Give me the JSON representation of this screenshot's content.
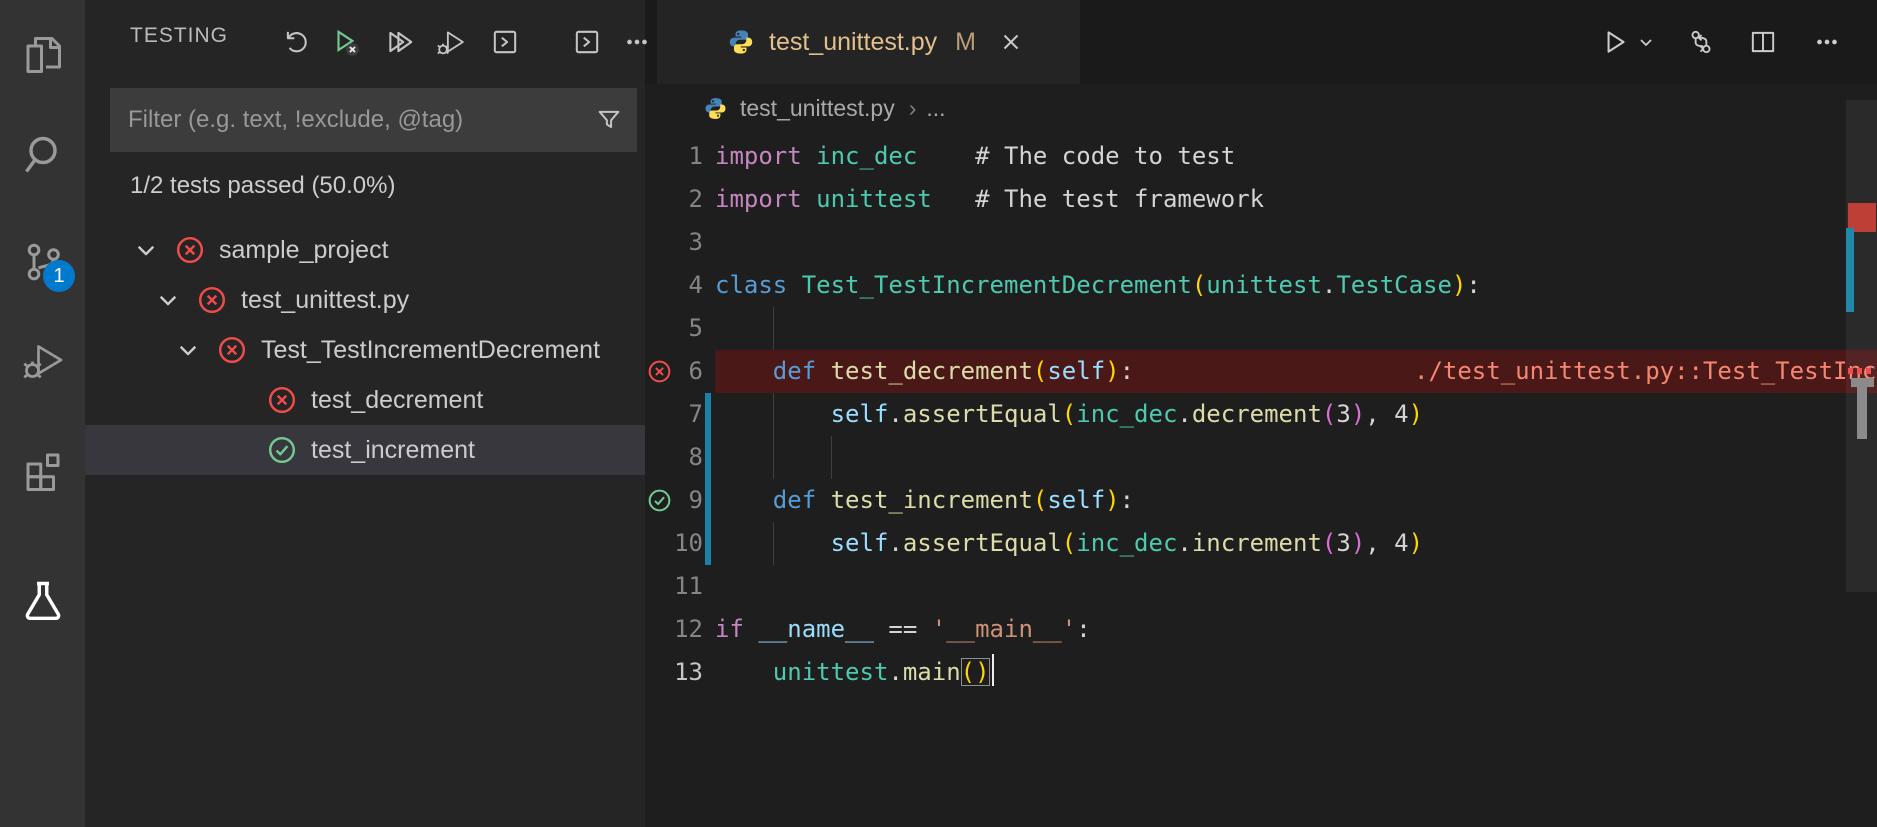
{
  "activity_bar": {
    "badge_color": "#007ACC",
    "items": [
      {
        "name": "explorer",
        "active": false,
        "badge": null
      },
      {
        "name": "search",
        "active": false,
        "badge": null
      },
      {
        "name": "source-control",
        "active": false,
        "badge": "1"
      },
      {
        "name": "run-and-debug",
        "active": false,
        "badge": null
      },
      {
        "name": "extensions",
        "active": false,
        "badge": null
      },
      {
        "name": "testing",
        "active": true,
        "badge": null
      }
    ]
  },
  "sidebar": {
    "title": "TESTING",
    "toolbar": [
      {
        "name": "refresh-tests"
      },
      {
        "name": "rerun-failed-tests"
      },
      {
        "name": "run-all-tests"
      },
      {
        "name": "debug-all-tests"
      },
      {
        "name": "show-output"
      },
      {
        "name": "open-panel"
      },
      {
        "name": "more-actions"
      }
    ],
    "filter": {
      "placeholder": "Filter (e.g. text, !exclude, @tag)"
    },
    "stats": "1/2 tests passed (50.0%)",
    "status_colors": {
      "fail": "#F14C4C",
      "pass": "#73C991"
    },
    "tree": [
      {
        "label": "sample_project",
        "state": "fail",
        "expanded": true,
        "leaf": false,
        "selected": false,
        "pad": 48
      },
      {
        "label": "test_unittest.py",
        "state": "fail",
        "expanded": true,
        "leaf": false,
        "selected": false,
        "pad": 70
      },
      {
        "label": "Test_TestIncrementDecrement",
        "state": "fail",
        "expanded": true,
        "leaf": false,
        "selected": false,
        "pad": 90
      },
      {
        "label": "test_decrement",
        "state": "fail",
        "expanded": false,
        "leaf": true,
        "selected": false,
        "pad": 140
      },
      {
        "label": "test_increment",
        "state": "pass",
        "expanded": false,
        "leaf": true,
        "selected": true,
        "pad": 140
      }
    ]
  },
  "editor": {
    "tab": {
      "label": "test_unittest.py",
      "git_status": "M",
      "language": "python",
      "modified_color": "#E2C08D"
    },
    "actions": [
      {
        "name": "run-file"
      },
      {
        "name": "run-dropdown"
      },
      {
        "name": "open-changes"
      },
      {
        "name": "split-editor"
      },
      {
        "name": "more-actions"
      }
    ],
    "breadcrumb": {
      "file": "test_unittest.py",
      "symbol": "..."
    },
    "colors": {
      "kw": "#C586C0",
      "type": "#4EC9B0",
      "def": "#569CD6",
      "fn": "#DCDCAA",
      "var": "#9CDCFE",
      "num": "#B5CEA8",
      "str": "#CE9178",
      "com": "#6A9955",
      "txt": "#D4D4D4",
      "b1": "#FFD700",
      "b2": "#DA70D6",
      "err": "#F48771",
      "fail_line_bg": "#4B1818",
      "modified_gutter": "#1B81A8"
    },
    "code": {
      "lines": [
        {
          "n": 1,
          "tokens": [
            [
              "kw",
              "import"
            ],
            [
              "txt",
              " "
            ],
            [
              "type",
              "inc_dec"
            ],
            [
              "txt",
              "    "
            ],
            [
              "com",
              "# The code to test"
            ]
          ]
        },
        {
          "n": 2,
          "tokens": [
            [
              "kw",
              "import"
            ],
            [
              "txt",
              " "
            ],
            [
              "type",
              "unittest"
            ],
            [
              "txt",
              "   "
            ],
            [
              "com",
              "# The test framework"
            ]
          ]
        },
        {
          "n": 3,
          "tokens": []
        },
        {
          "n": 4,
          "tokens": [
            [
              "def",
              "class"
            ],
            [
              "txt",
              " "
            ],
            [
              "type",
              "Test_TestIncrementDecrement"
            ],
            [
              "b1",
              "("
            ],
            [
              "type",
              "unittest"
            ],
            [
              "txt",
              "."
            ],
            [
              "type",
              "TestCase"
            ],
            [
              "b1",
              ")"
            ],
            [
              "txt",
              ":"
            ]
          ]
        },
        {
          "n": 5,
          "tokens": [],
          "guides": [
            1
          ]
        },
        {
          "n": 6,
          "tokens": [
            [
              "txt",
              "    "
            ],
            [
              "def",
              "def"
            ],
            [
              "txt",
              " "
            ],
            [
              "fn",
              "test_decrement"
            ],
            [
              "b1",
              "("
            ],
            [
              "var",
              "self"
            ],
            [
              "b1",
              ")"
            ],
            [
              "txt",
              ":"
            ]
          ],
          "icon": "fail",
          "bg": "fail",
          "error": "./test_unittest.py::Test_TestIncrementDecrement"
        },
        {
          "n": 7,
          "tokens": [
            [
              "txt",
              "        "
            ],
            [
              "var",
              "self"
            ],
            [
              "txt",
              "."
            ],
            [
              "fn",
              "assertEqual"
            ],
            [
              "b1",
              "("
            ],
            [
              "type",
              "inc_dec"
            ],
            [
              "txt",
              "."
            ],
            [
              "fn",
              "decrement"
            ],
            [
              "b2",
              "("
            ],
            [
              "num",
              "3"
            ],
            [
              "b2",
              ")"
            ],
            [
              "txt",
              ", "
            ],
            [
              "num",
              "4"
            ],
            [
              "b1",
              ")"
            ]
          ],
          "mod": true,
          "guides": [
            1
          ]
        },
        {
          "n": 8,
          "tokens": [],
          "mod": true,
          "guides": [
            1,
            2
          ]
        },
        {
          "n": 9,
          "tokens": [
            [
              "txt",
              "    "
            ],
            [
              "def",
              "def"
            ],
            [
              "txt",
              " "
            ],
            [
              "fn",
              "test_increment"
            ],
            [
              "b1",
              "("
            ],
            [
              "var",
              "self"
            ],
            [
              "b1",
              ")"
            ],
            [
              "txt",
              ":"
            ]
          ],
          "icon": "pass",
          "mod": true
        },
        {
          "n": 10,
          "tokens": [
            [
              "txt",
              "        "
            ],
            [
              "var",
              "self"
            ],
            [
              "txt",
              "."
            ],
            [
              "fn",
              "assertEqual"
            ],
            [
              "b1",
              "("
            ],
            [
              "type",
              "inc_dec"
            ],
            [
              "txt",
              "."
            ],
            [
              "fn",
              "increment"
            ],
            [
              "b2",
              "("
            ],
            [
              "num",
              "3"
            ],
            [
              "b2",
              ")"
            ],
            [
              "txt",
              ", "
            ],
            [
              "num",
              "4"
            ],
            [
              "b1",
              ")"
            ]
          ],
          "mod": true,
          "guides": [
            1
          ]
        },
        {
          "n": 11,
          "tokens": []
        },
        {
          "n": 12,
          "tokens": [
            [
              "kw",
              "if"
            ],
            [
              "txt",
              " "
            ],
            [
              "var",
              "__name__"
            ],
            [
              "txt",
              " == "
            ],
            [
              "str",
              "'__main__'"
            ],
            [
              "txt",
              ":"
            ]
          ]
        },
        {
          "n": 13,
          "tokens": [
            [
              "txt",
              "    "
            ],
            [
              "type",
              "unittest"
            ],
            [
              "txt",
              "."
            ],
            [
              "fn",
              "main"
            ],
            [
              "b1",
              "()",
              "match"
            ]
          ],
          "cursor": true,
          "active": true
        }
      ]
    }
  }
}
